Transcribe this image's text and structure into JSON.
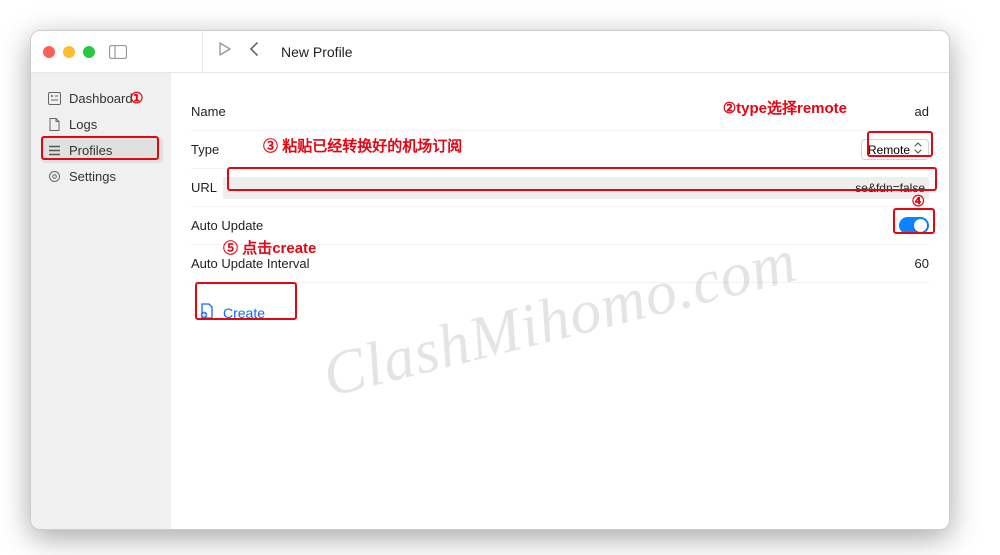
{
  "titlebar": {
    "title": "New Profile"
  },
  "sidebar": {
    "items": [
      {
        "label": "Dashboard"
      },
      {
        "label": "Logs"
      },
      {
        "label": "Profiles"
      },
      {
        "label": "Settings"
      }
    ]
  },
  "form": {
    "name_label": "Name",
    "name_value": "ad",
    "type_label": "Type",
    "type_value": "Remote",
    "url_label": "URL",
    "url_suffix": "se&fdn=false",
    "auto_update_label": "Auto Update",
    "interval_label": "Auto Update Interval",
    "interval_value": "60",
    "create_label": "Create"
  },
  "annotations": {
    "a1": "①",
    "a2": "②type选择remote",
    "a3": "③",
    "a3_text": "粘贴已经转换好的机场订阅",
    "a4": "④",
    "a5": "⑤",
    "a5_text": "点击create"
  },
  "watermark": "ClashMihomo.com"
}
